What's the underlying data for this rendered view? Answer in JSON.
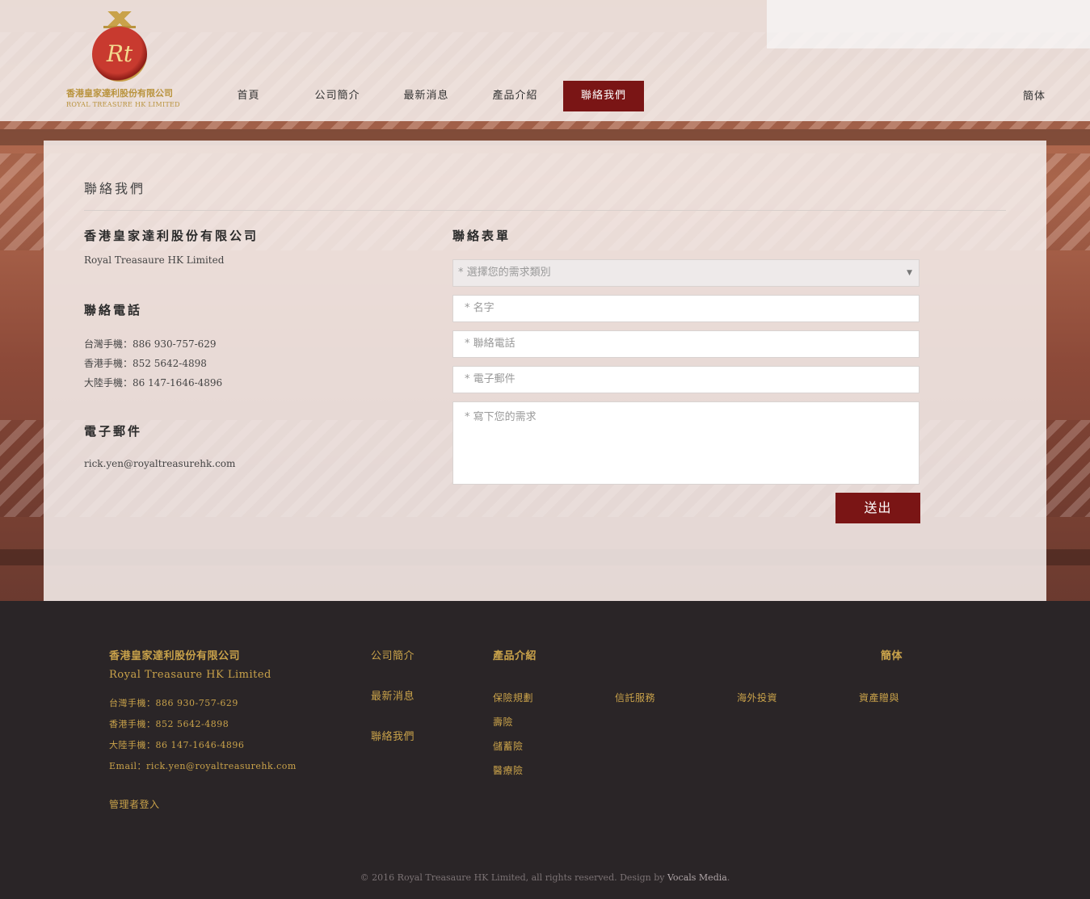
{
  "brand": {
    "logo_mark": "Rt",
    "name_cn": "香港皇家達利股份有限公司",
    "name_en": "ROYAL TREASURE HK LIMITED"
  },
  "nav": {
    "items": [
      "首頁",
      "公司簡介",
      "最新消息",
      "產品介紹",
      "聯絡我們"
    ],
    "active": "聯絡我們",
    "lang": "簡体"
  },
  "colors": {
    "accent": "#7a1515",
    "gold": "#c9a24a",
    "footer_bg": "#2a2527"
  },
  "page": {
    "title": "聯絡我們"
  },
  "company": {
    "name": "香港皇家達利股份有限公司",
    "name_en": "Royal Treasaure HK Limited"
  },
  "phone": {
    "heading": "聯絡電話",
    "lines": [
      "台灣手機：886 930-757-629",
      "香港手機：852 5642-4898",
      "大陸手機：86 147-1646-4896"
    ]
  },
  "email": {
    "heading": "電子郵件",
    "address": "rick.yen@royaltreasurehk.com"
  },
  "form": {
    "heading": "聯絡表單",
    "category_placeholder": "* 選擇您的需求類別",
    "name_placeholder": "* 名字",
    "phone_placeholder": "* 聯絡電話",
    "email_placeholder": "* 電子郵件",
    "message_placeholder": "*  寫下您的需求",
    "submit": "送出"
  },
  "footer": {
    "company": "香港皇家達利股份有限公司",
    "company_en": "Royal Treasaure HK Limited",
    "phones": [
      "台灣手機：886 930-757-629",
      "香港手機：852 5642-4898",
      "大陸手機：86 147-1646-4896"
    ],
    "email": "Email：rick.yen@royaltreasurehk.com",
    "admin": "管理者登入",
    "links": [
      "公司簡介",
      "最新消息",
      "聯絡我們"
    ],
    "products_heading": "產品介紹",
    "products": [
      "保險規劃",
      "壽險",
      "儲蓄險",
      "醫療險"
    ],
    "services": [
      "信託服務",
      "海外投資",
      "資產贈與"
    ],
    "lang": "簡体",
    "copyright": "© 2016 Royal Treasaure HK Limited, all rights reserved. Design by ",
    "designer": "Vocals Media",
    "period": "."
  }
}
